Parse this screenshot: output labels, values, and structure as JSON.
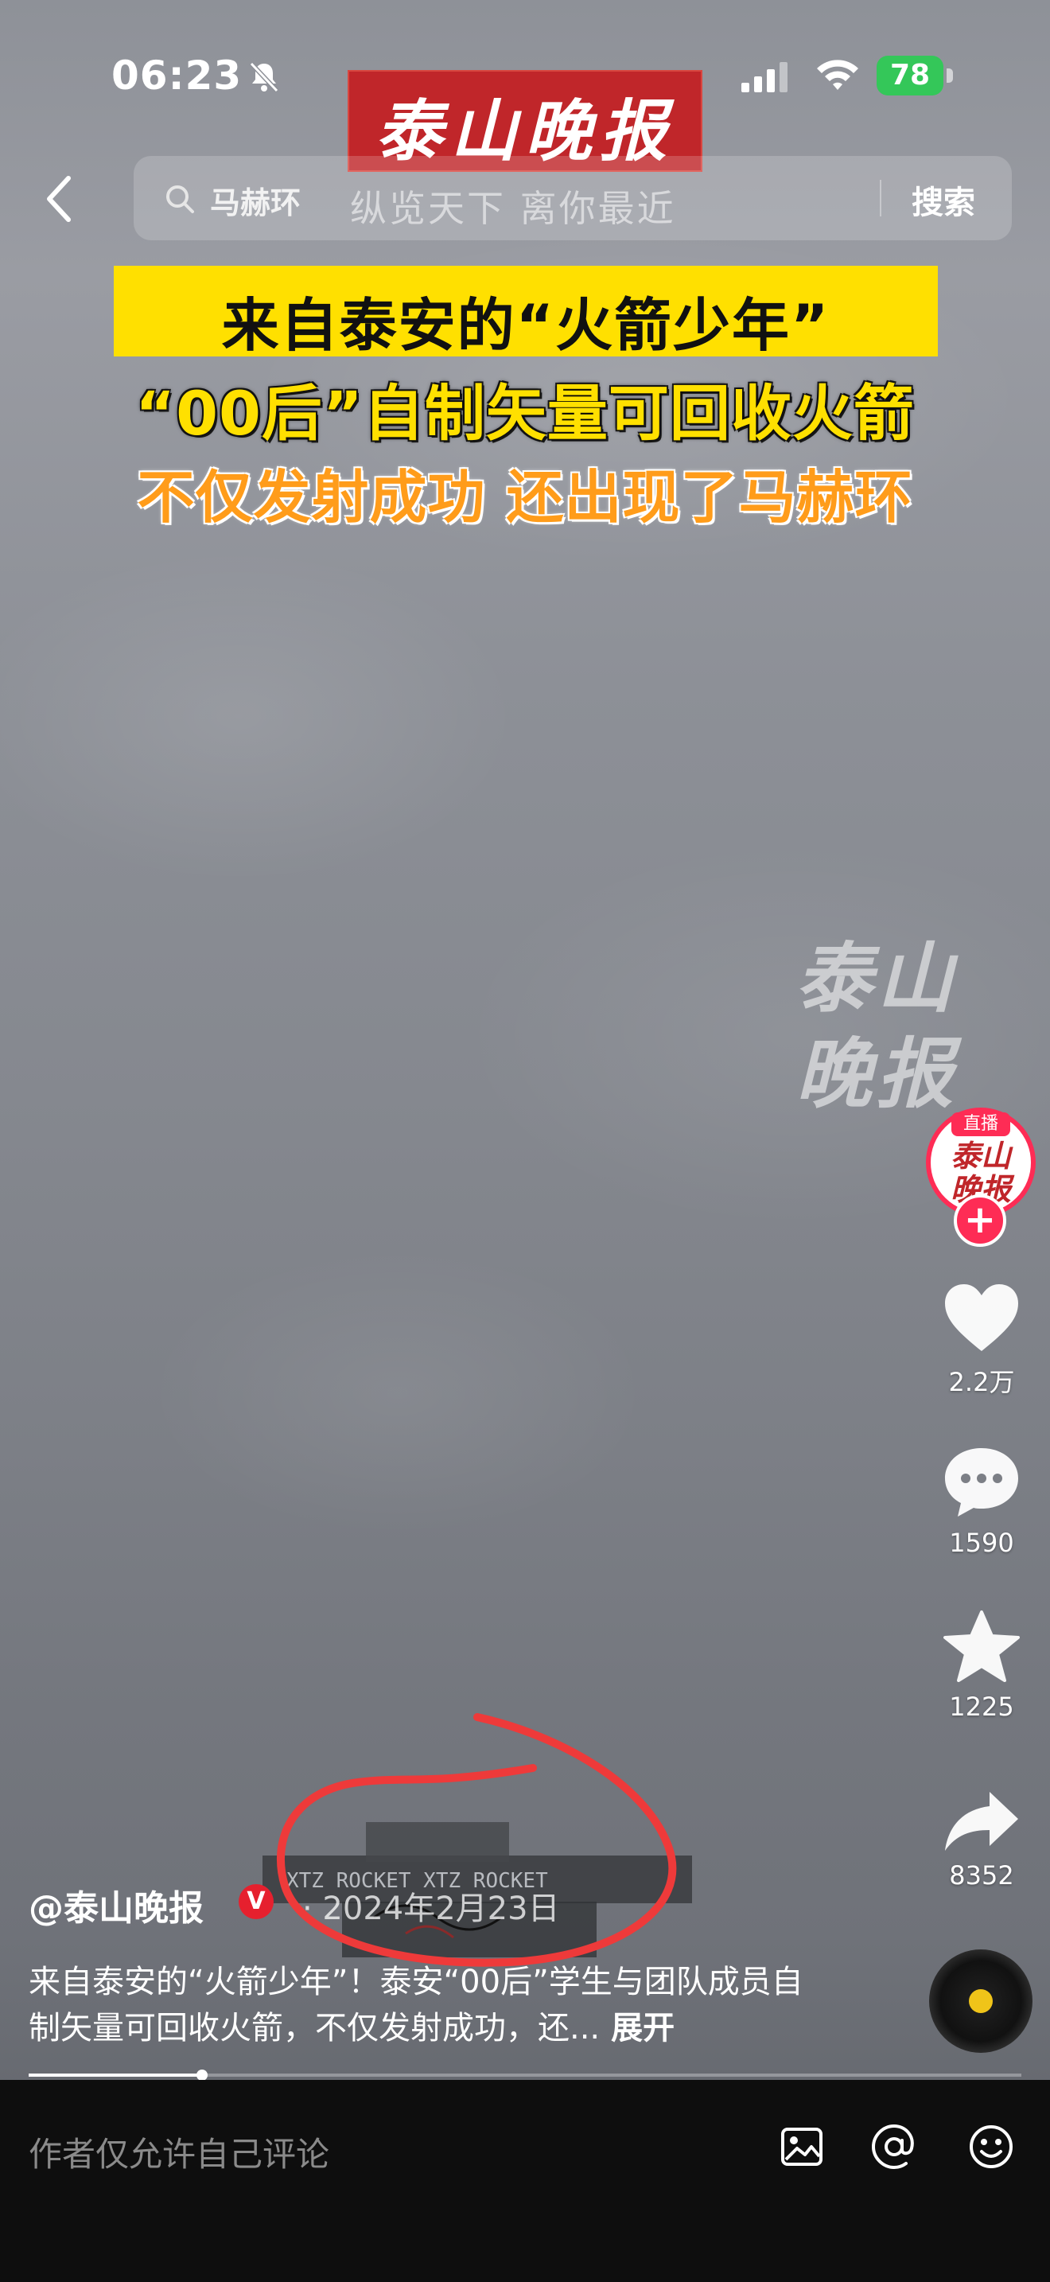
{
  "status_bar": {
    "time": "06:23",
    "battery": "78",
    "icons": [
      "mute-icon",
      "signal-icon",
      "wifi-icon",
      "battery-icon"
    ]
  },
  "banner": {
    "logo_text": "泰山晚报"
  },
  "search": {
    "query": "马赫环",
    "slogan": "纵览天下  离你最近",
    "button_label": "搜索"
  },
  "headline": {
    "line1": "来自泰安的“火箭少年”",
    "line2": "“00后”自制矢量可回收火箭",
    "line3": "不仅发射成功 还出现了马赫环"
  },
  "watermark": {
    "text_line1": "泰山",
    "text_line2": "晚报"
  },
  "board": {
    "label": "XTZ ROCKET   XTZ ROCKET"
  },
  "sidebar": {
    "live_label": "直播",
    "avatar_logo_line1": "泰山",
    "avatar_logo_line2": "晚报",
    "like_count": "2.2万",
    "comment_count": "1590",
    "favorite_count": "1225",
    "share_count": "8352"
  },
  "post": {
    "author": "@泰山晚报",
    "verified_mark": "V",
    "date": "· 2024年2月23日",
    "caption": "来自泰安的“火箭少年”！泰安“00后”学生与团队成员自制矢量可回收火箭，不仅发射成功，还...",
    "expand_label": "展开",
    "progress_fraction": 0.175
  },
  "comment_bar": {
    "placeholder": "作者仅允许自己评论"
  },
  "colors": {
    "accent_red": "#fe2c55",
    "headline_yellow": "#ffe000",
    "headline_orange": "#ff9c1a",
    "logo_red": "#c0262a",
    "annotation_red": "#ee3a3a"
  }
}
